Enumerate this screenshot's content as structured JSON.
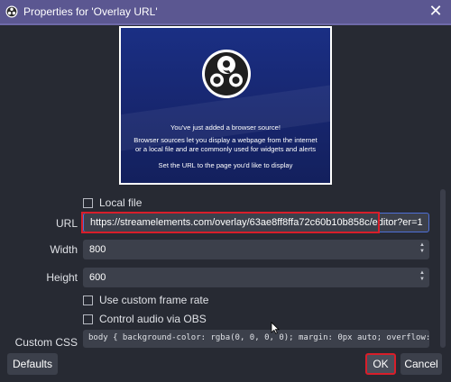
{
  "window": {
    "title": "Properties for 'Overlay URL'",
    "close_glyph": "✕",
    "accent_color": "#5b5791"
  },
  "preview": {
    "logo": "obs-logo",
    "line1": "You've just added a browser source!",
    "line2": "Browser sources let you display a webpage from the internet or a local file and are commonly used for widgets and alerts",
    "line3": "Set the URL to the page you'd like to display"
  },
  "form": {
    "local_file": {
      "label": "Local file",
      "checked": false
    },
    "url": {
      "label": "URL",
      "value": "https://streamelements.com/overlay/63ae8ff8ffa72c60b10b858c/editor?er=1"
    },
    "width": {
      "label": "Width",
      "value": "800"
    },
    "height": {
      "label": "Height",
      "value": "600"
    },
    "custom_frame_rate": {
      "label": "Use custom frame rate",
      "checked": false
    },
    "control_audio": {
      "label": "Control audio via OBS",
      "checked": false
    },
    "custom_css": {
      "label": "Custom CSS",
      "value": "body { background-color: rgba(0, 0, 0, 0); margin: 0px auto; overflow:"
    }
  },
  "buttons": {
    "defaults": "Defaults",
    "ok": "OK",
    "cancel": "Cancel"
  },
  "highlight_color": "#d81e2a"
}
